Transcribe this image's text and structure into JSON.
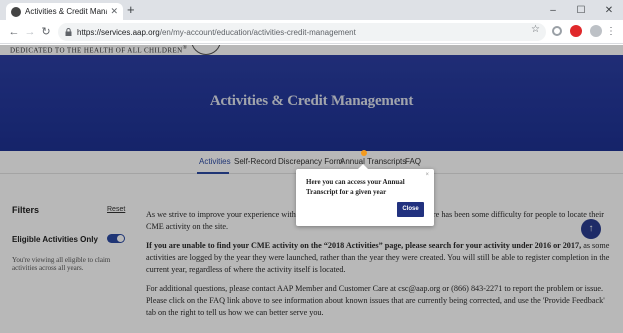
{
  "browser": {
    "tab_title": "Activities & Credit Management",
    "tab_close": "✕",
    "new_tab": "+",
    "url_host": "https://services.aap.org",
    "url_path": "/en/my-account/education/activities-credit-management",
    "window_controls": [
      "–",
      "☐",
      "✕"
    ],
    "icons": [
      "back-icon",
      "forward-icon",
      "reload-icon",
      "lock-icon",
      "star-icon",
      "extension-icon",
      "opera-icon",
      "profile-icon",
      "menu-icon"
    ]
  },
  "site": {
    "tagline": "DEDICATED TO THE HEALTH OF ALL CHILDREN",
    "tagline_mark": "®"
  },
  "hero": {
    "title": "Activities & Credit Management"
  },
  "subnav": {
    "items": [
      "Activities",
      "Self-Record",
      "Discrepancy Form",
      "Annual Transcripts",
      "FAQ"
    ],
    "active": "Activities"
  },
  "filters": {
    "title": "Filters",
    "reset_label": "Reset",
    "eligible_label": "Eligible Activities Only",
    "eligible_enabled": true,
    "eligible_desc": "You're viewing all eligible to claim activities across all years."
  },
  "article": {
    "p1": "As we strive to improve your experience with the new PediaLink, we are aware that there has been some difficulty for people to locate their CME activity on the site.",
    "p2_bold": "If you are unable to find your CME activity on the “2018 Activities” page, please search for your activity under 2016 or 2017,",
    "p2_rest": " as some activities are logged by the year they were launched, rather than the year they were created.  You will still be able to register completion in the current year, regardless of where the activity itself is located.",
    "p3": "For additional questions, please contact AAP Member and Customer Care at csc@aap.org or (866) 843-2271 to report the problem or issue.  Please click on the FAQ link above to see information about known issues that are currently being corrected, and use the 'Provide Feedback' tab on the right to tell us how we can better serve you."
  },
  "popover": {
    "text": "Here you can access your Annual Transcript for a given year",
    "close_x": "×",
    "close_label": "Close"
  },
  "fab": {
    "icon": "↑"
  },
  "colors": {
    "brand_blue": "#2c3fa3",
    "accent_orange": "#f39a1e",
    "button_navy": "#22327f"
  }
}
